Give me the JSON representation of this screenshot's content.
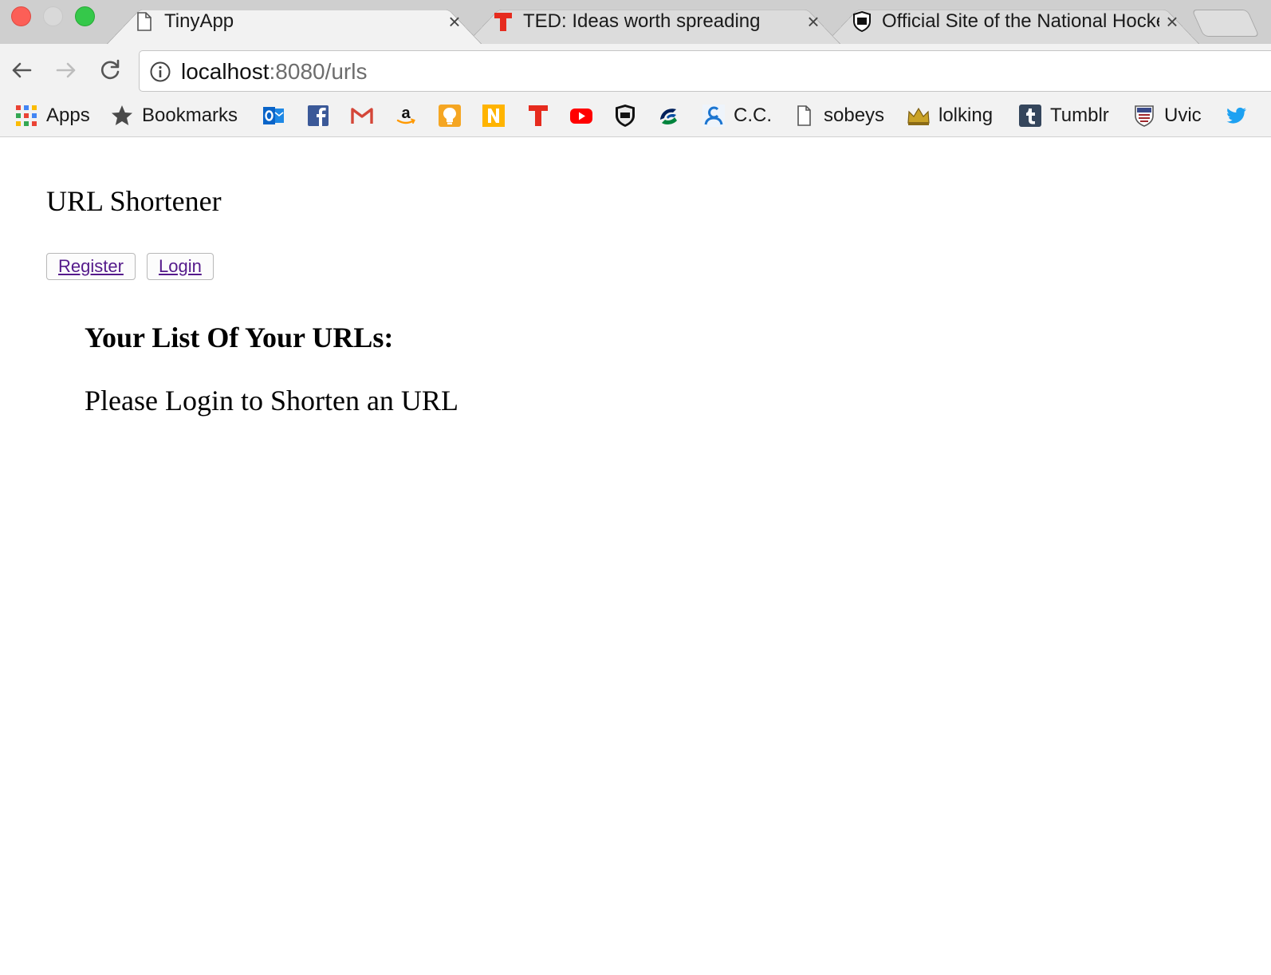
{
  "browser": {
    "tabs": [
      {
        "title": "TinyApp",
        "icon": "page-icon",
        "active": true
      },
      {
        "title": "TED: Ideas worth spreading",
        "icon": "ted-icon",
        "active": false
      },
      {
        "title": "Official Site of the National Hockey League",
        "icon": "nhl-icon",
        "active": false
      }
    ],
    "close_glyph": "×",
    "address_bar": {
      "host": "localhost",
      "rest": ":8080/urls"
    },
    "bookmarks": [
      {
        "label": "Apps",
        "icon": "apps-grid-icon"
      },
      {
        "label": "Bookmarks",
        "icon": "star-icon"
      },
      {
        "label": "",
        "icon": "outlook-icon"
      },
      {
        "label": "",
        "icon": "facebook-icon"
      },
      {
        "label": "",
        "icon": "gmail-icon"
      },
      {
        "label": "",
        "icon": "amazon-icon"
      },
      {
        "label": "",
        "icon": "bulb-icon"
      },
      {
        "label": "",
        "icon": "n-icon"
      },
      {
        "label": "",
        "icon": "ted-icon"
      },
      {
        "label": "",
        "icon": "youtube-icon"
      },
      {
        "label": "",
        "icon": "nhl-icon"
      },
      {
        "label": "",
        "icon": "canucks-icon"
      },
      {
        "label": "C.C.",
        "icon": "cc-icon"
      },
      {
        "label": "sobeys",
        "icon": "page-icon"
      },
      {
        "label": "lolking",
        "icon": "crown-icon"
      },
      {
        "label": "Tumblr",
        "icon": "tumblr-icon"
      },
      {
        "label": "Uvic",
        "icon": "uvic-icon"
      },
      {
        "label": "",
        "icon": "twitter-icon"
      }
    ]
  },
  "page": {
    "title": "URL Shortener",
    "nav": {
      "register_label": "Register",
      "login_label": "Login"
    },
    "heading": "Your List Of Your URLs:",
    "message": "Please Login to Shorten an URL"
  },
  "colors": {
    "link_visited": "#551a8b",
    "traffic_red": "#fc5f57",
    "traffic_green": "#35c84a"
  }
}
